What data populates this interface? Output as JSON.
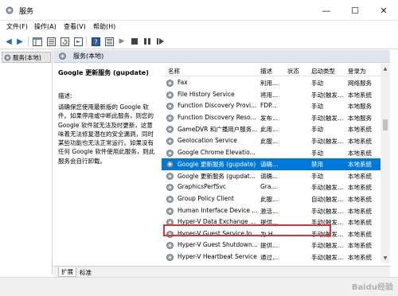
{
  "window": {
    "title": "服务",
    "minimize": "—",
    "maximize": "☐",
    "close": "✕"
  },
  "menu": {
    "file": "文件(F)",
    "action": "操作(A)",
    "view": "查看(V)",
    "help": "帮助(H)"
  },
  "tree": {
    "root": "服务(本地)"
  },
  "panel": {
    "header": "服务(本地)",
    "selected_title": "Google 更新服务 (gupdate)",
    "desc_label": "描述:",
    "desc_body": "请确保您使用最新版的 Google 软件。如果停用或中断此服务，则您的 Google 软件就无法及时更新，这意味着无法修复潜在的安全漏洞，同时某些功能也无法正常运行。如果没有任何 Google 软件使用此服务，则此服务会自行卸载。"
  },
  "columns": {
    "name": "名称",
    "desc": "描述",
    "status": "状态",
    "startup": "启动类型",
    "logon": "登录为"
  },
  "services": [
    {
      "name": "Fax",
      "desc": "利用...",
      "status": "",
      "startup": "手动",
      "logon": "网络服务"
    },
    {
      "name": "File History Service",
      "desc": "将用...",
      "status": "",
      "startup": "手动(触发...",
      "logon": "本地系统"
    },
    {
      "name": "Function Discovery Provi...",
      "desc": "FDP...",
      "status": "",
      "startup": "手动",
      "logon": "本地服务"
    },
    {
      "name": "Function Discovery Reso...",
      "desc": "发布...",
      "status": "",
      "startup": "手动(触发...",
      "logon": "本地服务"
    },
    {
      "name": "GameDVR 和广播用户服务...",
      "desc": "此用...",
      "status": "",
      "startup": "手动",
      "logon": "本地系统"
    },
    {
      "name": "Geolocation Service",
      "desc": "此服...",
      "status": "",
      "startup": "手动(触发...",
      "logon": "本地系统"
    },
    {
      "name": "Google Chrome Elevatio...",
      "desc": "",
      "status": "",
      "startup": "手动",
      "logon": "本地系统"
    },
    {
      "name": "Google 更新服务 (gupdate)",
      "desc": "请确...",
      "status": "",
      "startup": "禁用",
      "logon": "本地系统",
      "selected": true
    },
    {
      "name": "Google 更新服务 (gupdat...",
      "desc": "请确...",
      "status": "",
      "startup": "手动",
      "logon": "本地系统"
    },
    {
      "name": "GraphicsPerfSvc",
      "desc": "Gra...",
      "status": "",
      "startup": "手动(触发...",
      "logon": "本地系统"
    },
    {
      "name": "Group Policy Client",
      "desc": "此服...",
      "status": "",
      "startup": "自动(触发...",
      "logon": "本地系统"
    },
    {
      "name": "Human Interface Device ...",
      "desc": "激活...",
      "status": "",
      "startup": "手动(触发...",
      "logon": "本地系统"
    },
    {
      "name": "Hyper-V Data Exchange ...",
      "desc": "提供...",
      "status": "",
      "startup": "手动(触发...",
      "logon": "本地系统"
    },
    {
      "name": "Hyper-V Guest Service In...",
      "desc": "为 H...",
      "status": "",
      "startup": "手动(触发...",
      "logon": "本地系统"
    },
    {
      "name": "Hyper-V Guest Shutdown...",
      "desc": "提供...",
      "status": "",
      "startup": "手动(触发...",
      "logon": "本地系统"
    },
    {
      "name": "Hyper-V Heartbeat Service",
      "desc": "通过...",
      "status": "",
      "startup": "手动(触发...",
      "logon": "本地系统"
    }
  ],
  "tabs": {
    "extended": "扩展",
    "standard": "标准"
  },
  "watermark": "Baidu经验"
}
